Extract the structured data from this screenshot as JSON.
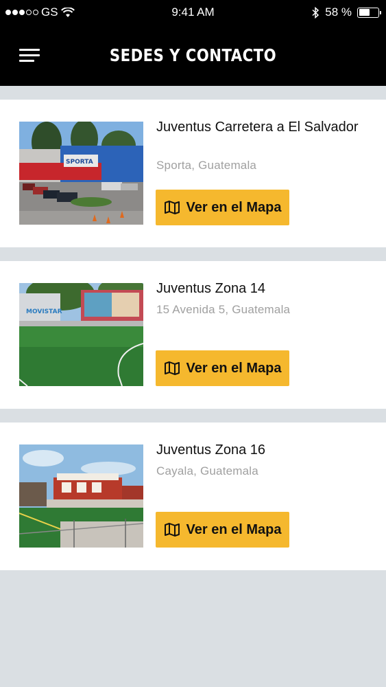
{
  "status_bar": {
    "carrier": "GS",
    "time": "9:41 AM",
    "battery_percent": "58 %",
    "battery_level": 0.58,
    "signal_bars_filled": 3,
    "signal_bars_total": 5,
    "icons": [
      "signal-dots-icon",
      "wifi-icon",
      "bluetooth-icon",
      "battery-icon"
    ]
  },
  "nav": {
    "title": "SEDES Y CONTACTO",
    "menu_icon": "hamburger-menu-icon"
  },
  "locations": [
    {
      "title": "Juventus Carretera a El Salvador",
      "subtitle": "Sporta, Guatemala",
      "button_label": "Ver en el Mapa",
      "button_icon": "map-icon",
      "photo_sign": "SPORTA"
    },
    {
      "title": "Juventus Zona 14",
      "subtitle": "15 Avenida 5, Guatemala",
      "button_label": "Ver en el Mapa",
      "button_icon": "map-icon",
      "photo_sign": "MOVISTAR"
    },
    {
      "title": "Juventus Zona 16",
      "subtitle": "Cayala, Guatemala",
      "button_label": "Ver en el Mapa",
      "button_icon": "map-icon"
    }
  ],
  "colors": {
    "header": "#000000",
    "accent_button": "#f5b82e",
    "page_background": "#dadfe3",
    "card_background": "#ffffff",
    "subtitle_text": "#a0a0a0"
  }
}
